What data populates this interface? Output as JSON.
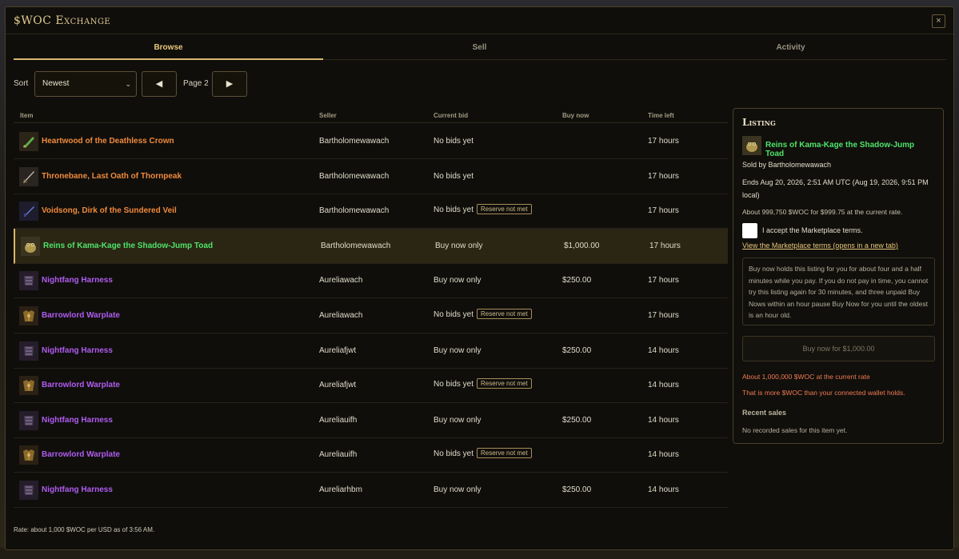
{
  "window": {
    "title": "$WOC Exchange",
    "close_glyph": "×"
  },
  "tabs": [
    {
      "label": "Browse",
      "active": true
    },
    {
      "label": "Sell",
      "active": false
    },
    {
      "label": "Activity",
      "active": false
    }
  ],
  "controls": {
    "sort_label": "Sort",
    "sort_value": "Newest",
    "prev_glyph": "◀",
    "next_glyph": "▶",
    "page_label": "Page 2"
  },
  "table": {
    "headers": [
      "Item",
      "Seller",
      "Current bid",
      "Buy now",
      "Time left"
    ],
    "rows": [
      {
        "name": "Heartwood of the Deathless Crown",
        "color": "#f08a3c",
        "icon": "leaf-blade-icon",
        "seller": "Bartholomewawach",
        "bid": "No bids yet",
        "reserve": "",
        "buy": "",
        "time": "17 hours"
      },
      {
        "name": "Thronebane, Last Oath of Thornpeak",
        "color": "#f08a3c",
        "icon": "sword-icon",
        "seller": "Bartholomewawach",
        "bid": "No bids yet",
        "reserve": "",
        "buy": "",
        "time": "17 hours"
      },
      {
        "name": "Voidsong, Dirk of the Sundered Veil",
        "color": "#f08a3c",
        "icon": "dagger-icon",
        "seller": "Bartholomewawach",
        "bid": "No bids yet",
        "reserve": "Reserve not met",
        "buy": "",
        "time": "17 hours"
      },
      {
        "name": "Reins of Kama-Kage the Shadow-Jump Toad",
        "color": "#4fe36b",
        "icon": "toad-mount-icon",
        "seller": "Bartholomewawach",
        "bid": "Buy now only",
        "reserve": "",
        "buy": "$1,000.00",
        "time": "17 hours",
        "selected": true
      },
      {
        "name": "Nightfang Harness",
        "color": "#b05cf0",
        "icon": "harness-icon",
        "seller": "Aureliawach",
        "bid": "Buy now only",
        "reserve": "",
        "buy": "$250.00",
        "time": "17 hours"
      },
      {
        "name": "Barrowlord Warplate",
        "color": "#b05cf0",
        "icon": "chestplate-icon",
        "seller": "Aureliawach",
        "bid": "No bids yet",
        "reserve": "Reserve not met",
        "buy": "",
        "time": "17 hours"
      },
      {
        "name": "Nightfang Harness",
        "color": "#b05cf0",
        "icon": "harness-icon",
        "seller": "Aureliafjwt",
        "bid": "Buy now only",
        "reserve": "",
        "buy": "$250.00",
        "time": "14 hours"
      },
      {
        "name": "Barrowlord Warplate",
        "color": "#b05cf0",
        "icon": "chestplate-icon",
        "seller": "Aureliafjwt",
        "bid": "No bids yet",
        "reserve": "Reserve not met",
        "buy": "",
        "time": "14 hours"
      },
      {
        "name": "Nightfang Harness",
        "color": "#b05cf0",
        "icon": "harness-icon",
        "seller": "Aureliauifh",
        "bid": "Buy now only",
        "reserve": "",
        "buy": "$250.00",
        "time": "14 hours"
      },
      {
        "name": "Barrowlord Warplate",
        "color": "#b05cf0",
        "icon": "chestplate-icon",
        "seller": "Aureliauifh",
        "bid": "No bids yet",
        "reserve": "Reserve not met",
        "buy": "",
        "time": "14 hours"
      },
      {
        "name": "Nightfang Harness",
        "color": "#b05cf0",
        "icon": "harness-icon",
        "seller": "Aureliarhbm",
        "bid": "Buy now only",
        "reserve": "",
        "buy": "$250.00",
        "time": "14 hours"
      }
    ]
  },
  "footer": {
    "rate": "Rate: about 1,000 $WOC per USD as of 3:56 AM."
  },
  "listing": {
    "title": "Listing",
    "item_name": "Reins of Kama-Kage the Shadow-Jump Toad",
    "item_icon": "toad-mount-icon",
    "sold_by": "Sold by Bartholomewawach",
    "ends": "Ends Aug 20, 2026, 2:51 AM UTC (Aug 19, 2026, 9:51 PM local)",
    "about_price": "About 999,750 $WOC for $999.75 at the current rate.",
    "accept_label": "I accept the Marketplace terms.",
    "terms_link": "View the Marketplace terms (opens in a new tab)",
    "info": "Buy now holds this listing for you for about four and a half minutes while you pay. If you do not pay in time, you cannot try this listing again for 30 minutes, and three unpaid Buy Nows within an hour pause Buy Now for you until the oldest is an hour old.",
    "buy_button": "Buy now for $1,000.00",
    "warn_rate": "About 1,000,000 $WOC at the current rate",
    "warn_wallet": "That is more $WOC than your connected wallet holds.",
    "recent_label": "Recent sales",
    "recent_none": "No recorded sales for this item yet."
  }
}
